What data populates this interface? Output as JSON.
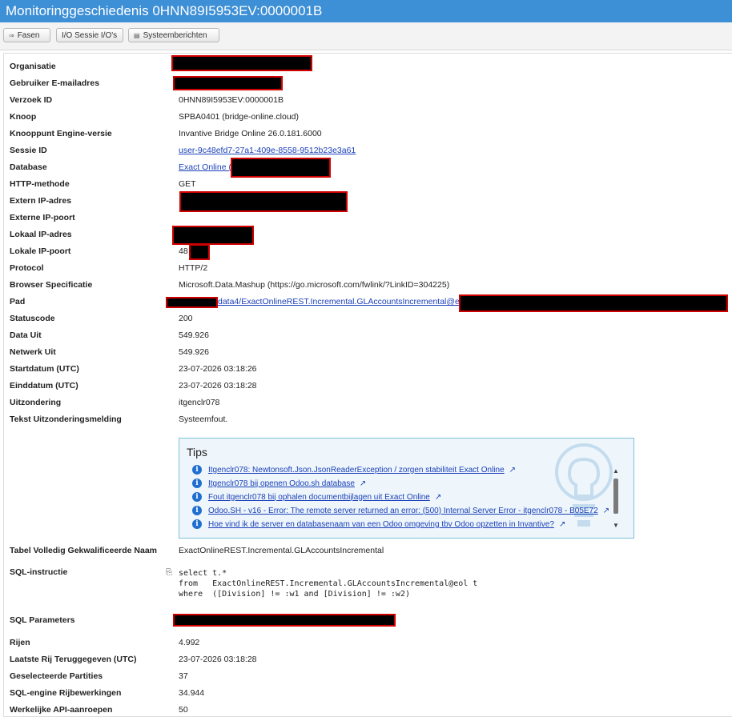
{
  "title": "Monitoringgeschiedenis 0HNN89I5953EV:0000001B",
  "toolbar": {
    "fasen": "Fasen",
    "sessie": "I/O Sessie I/O's",
    "systeem": "Systeemberichten"
  },
  "fields": {
    "organisatie": "Organisatie",
    "email": "Gebruiker E-mailadres",
    "verzoek_id": "Verzoek ID",
    "knoop": "Knoop",
    "engine": "Knooppunt Engine-versie",
    "sessie_id": "Sessie ID",
    "database": "Database",
    "http": "HTTP-methode",
    "ext_ip": "Extern IP-adres",
    "ext_port": "Externe IP-poort",
    "lok_ip": "Lokaal IP-adres",
    "lok_port": "Lokale IP-poort",
    "protocol": "Protocol",
    "browser": "Browser Specificatie",
    "pad": "Pad",
    "status": "Statuscode",
    "data_uit": "Data Uit",
    "netwerk_uit": "Netwerk Uit",
    "start": "Startdatum (UTC)",
    "eind": "Einddatum (UTC)",
    "uitz": "Uitzondering",
    "tekst_uitz": "Tekst Uitzonderingsmelding",
    "tabel": "Tabel Volledig Gekwalificeerde Naam",
    "sql": "SQL-instructie",
    "sql_params": "SQL Parameters",
    "rijen": "Rijen",
    "laatste_rij": "Laatste Rij Teruggegeven (UTC)",
    "partities": "Geselecteerde Partities",
    "sql_engine": "SQL-engine Rijbewerkingen",
    "api": "Werkelijke API-aanroepen"
  },
  "values": {
    "verzoek_id": "0HNN89I5953EV:0000001B",
    "knoop": "SPBA0401 (bridge-online.cloud)",
    "engine": "Invantive Bridge Online 26.0.181.6000",
    "sessie_id": "user-9c48efd7-27a1-409e-8558-9512b23e3a61",
    "database": "Exact Online (n",
    "http": "GET",
    "lok_port": "48",
    "protocol": "HTTP/2",
    "browser": "Microsoft.Data.Mashup (https://go.microsoft.com/fwlink/?LinkID=304225)",
    "pad": "data4/ExactOnlineREST.Incremental.GLAccountsIncremental@eol?$f",
    "status": "200",
    "data_uit": "549.926",
    "netwerk_uit": "549.926",
    "start": "23-07-2026 03:18:26",
    "eind": "23-07-2026 03:18:28",
    "uitz": "itgenclr078",
    "tekst_uitz": "Systeemfout.",
    "tabel": "ExactOnlineREST.Incremental.GLAccountsIncremental",
    "sql_line1": "select t.*",
    "sql_line2": "from   ExactOnlineREST.Incremental.GLAccountsIncremental@eol t",
    "sql_line3": "where  ([Division] != :w1 and [Division] != :w2)",
    "rijen": "4.992",
    "laatste_rij": "23-07-2026 03:18:28",
    "partities": "37",
    "sql_engine": "34.944",
    "api": "50"
  },
  "tips": {
    "heading": "Tips",
    "items": [
      "Itgenclr078: Newtonsoft.Json.JsonReaderException / zorgen stabiliteit Exact Online",
      "Itgenclr078 bij openen Odoo.sh database",
      "Fout itgenclr078 bij ophalen documentbijlagen uit Exact Online",
      "Odoo.SH - v16 - Error: The remote server returned an error: (500) Internal Server Error - itgenclr078 - B05E72",
      "Hoe vind ik de server en databasenaam van een Odoo omgeving tbv Odoo opzetten in Invantive?"
    ]
  },
  "icons": {
    "info": "info-icon",
    "external": "external-link-icon",
    "copy": "copy-icon"
  }
}
